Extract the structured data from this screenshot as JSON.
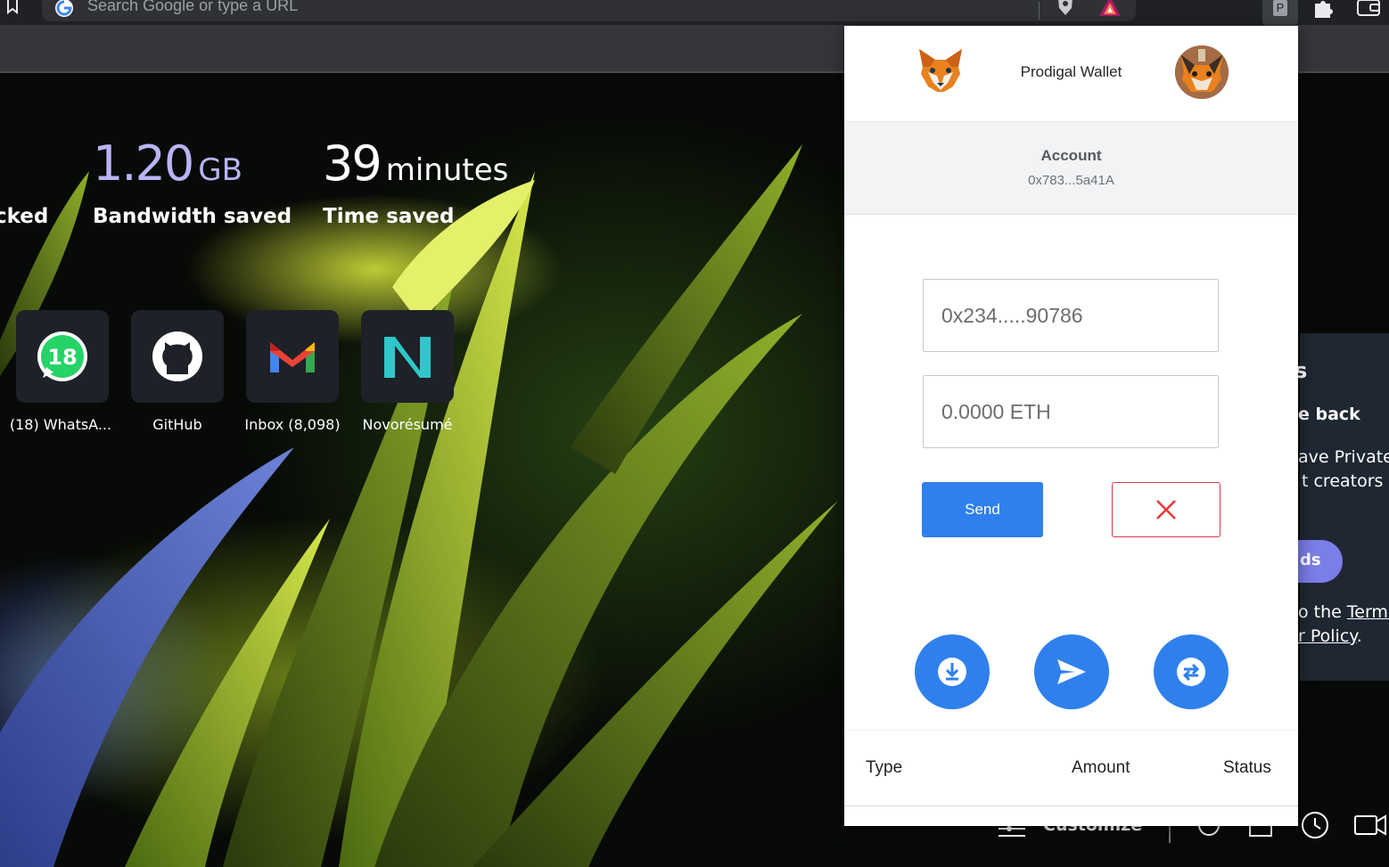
{
  "browser": {
    "omnibox_placeholder": "Search Google or type a URL",
    "extension_letter": "P"
  },
  "ntp": {
    "stats": [
      {
        "value": "",
        "unit": "",
        "label": "cked"
      },
      {
        "value": "1.20",
        "unit": "GB",
        "label": "Bandwidth saved"
      },
      {
        "value": "39",
        "unit": "minutes",
        "label": "Time saved"
      }
    ],
    "tiles": [
      {
        "label": "(18) WhatsA...",
        "icon": "whatsapp-icon",
        "badge": "18"
      },
      {
        "label": "GitHub",
        "icon": "github-icon"
      },
      {
        "label": "Inbox (8,098)",
        "icon": "gmail-icon"
      },
      {
        "label": "Novorésumé",
        "icon": "novoresume-icon"
      }
    ],
    "rewards_panel": {
      "line1": "s",
      "line2": "e back",
      "line3": "ave Private",
      "line4": "t creators",
      "button": "ds",
      "terms1": "o the ",
      "terms_link": "Terms",
      "terms2": "r Policy",
      "terms_end": "."
    },
    "customize_label": "Customize"
  },
  "wallet": {
    "title": "Prodigal Wallet",
    "account_label": "Account",
    "account_address": "0x783...5a41A",
    "recipient_placeholder": "0x234.....90786",
    "amount_placeholder": "0.0000 ETH",
    "send_label": "Send",
    "actions": [
      {
        "name": "receive",
        "icon": "download-icon"
      },
      {
        "name": "send",
        "icon": "paper-plane-icon"
      },
      {
        "name": "swap",
        "icon": "swap-arrows-icon"
      }
    ],
    "table_headers": [
      "Type",
      "Amount",
      "Status"
    ],
    "colors": {
      "primary": "#2f80ed",
      "danger": "#d73a49",
      "account_bg": "#f2f3f4"
    }
  }
}
